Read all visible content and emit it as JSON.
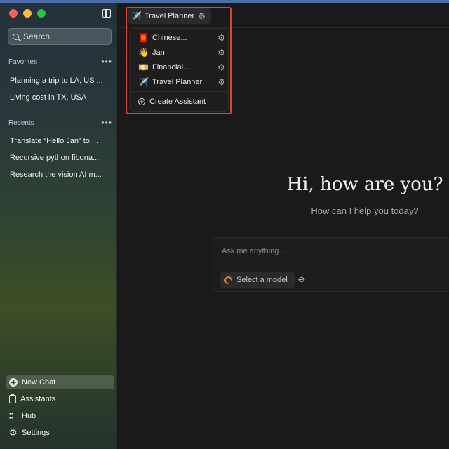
{
  "sidebar": {
    "search_placeholder": "Search",
    "favorites_label": "Favorites",
    "favorites": [
      "Planning a trip to LA, US ...",
      "Living cost in TX, USA"
    ],
    "recents_label": "Recents",
    "recents": [
      "Translate “Hello Jan” to ...",
      "Recursive python fibona...",
      "Research the vision AI m..."
    ],
    "nav": [
      {
        "label": "New Chat",
        "icon": "plus-circle-icon"
      },
      {
        "label": "Assistants",
        "icon": "clipboard-icon"
      },
      {
        "label": "Hub",
        "icon": "grid-icon"
      },
      {
        "label": "Settings",
        "icon": "gear-icon"
      }
    ],
    "more_glyph": "•••"
  },
  "header": {
    "assistant_emoji": "✈️",
    "assistant_name": "Travel Planner"
  },
  "dropdown": {
    "items": [
      {
        "emoji": "🧧",
        "label": "Chinese..."
      },
      {
        "emoji": "👋",
        "label": "Jan"
      },
      {
        "emoji": "💴",
        "label": "Financial..."
      },
      {
        "emoji": "✈️",
        "label": "Travel Planner"
      }
    ],
    "create_label": "Create Assistant"
  },
  "main": {
    "greeting": "Hi, how are you?",
    "subtitle": "How can I help you today?",
    "composer_placeholder": "Ask me anything...",
    "model_button": "Select a model"
  },
  "colors": {
    "highlight": "#e0432f",
    "model_accent": "#e07a3a"
  }
}
